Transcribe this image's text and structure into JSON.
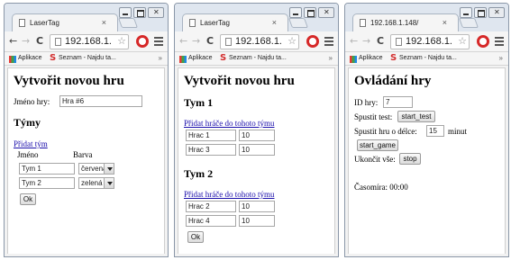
{
  "browser": {
    "bookmarks": {
      "apps": "Aplikace",
      "seznam": "Seznam - Najdu ta...",
      "more": "»"
    }
  },
  "windows": [
    {
      "tab_title": "LaserTag",
      "url": "192.168.1.",
      "page": {
        "title": "Vytvořit novou hru",
        "game_name_label": "Jméno hry:",
        "game_name_value": "Hra #6",
        "teams_heading": "Týmy",
        "add_team_link": "Přidat tým",
        "col_name": "Jméno",
        "col_color": "Barva",
        "teams": [
          {
            "name": "Tym 1",
            "color": "červená"
          },
          {
            "name": "Tym 2",
            "color": "zelená"
          }
        ],
        "ok_label": "Ok"
      }
    },
    {
      "tab_title": "LaserTag",
      "url": "192.168.1.",
      "page": {
        "title": "Vytvořit novou hru",
        "teams": [
          {
            "heading": "Tym 1",
            "add_player_link": "Přidat hráče do tohoto týmu",
            "players": [
              {
                "name": "Hrac 1",
                "value": "10"
              },
              {
                "name": "Hrac 3",
                "value": "10"
              }
            ]
          },
          {
            "heading": "Tym 2",
            "add_player_link": "Přidat hráče do tohoto týmu",
            "players": [
              {
                "name": "Hrac 2",
                "value": "10"
              },
              {
                "name": "Hrac 4",
                "value": "10"
              }
            ]
          }
        ],
        "ok_label": "Ok"
      }
    },
    {
      "tab_title": "192.168.1.148/",
      "url": "192.168.1.",
      "page": {
        "title": "Ovládání hry",
        "game_id_label": "ID hry:",
        "game_id_value": "7",
        "start_test_label": "Spustit test:",
        "start_test_button": "start_test",
        "start_game_label": "Spustit hru o délce:",
        "start_game_minutes": "15",
        "minutes_unit": "minut",
        "start_game_button": "start_game",
        "stop_label": "Ukončit vše:",
        "stop_button": "stop",
        "timer_label": "Časomíra: 00:00"
      }
    }
  ]
}
